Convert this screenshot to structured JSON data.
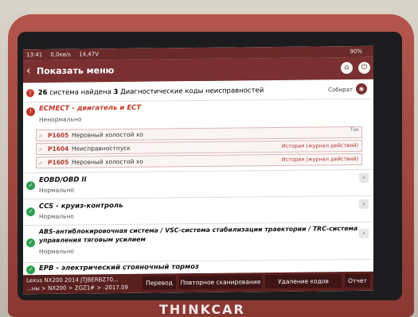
{
  "status_bar": {
    "time": "13:41",
    "net_speed": "0,0кв/s",
    "voltage": "14,47V",
    "battery": "90%"
  },
  "header": {
    "title": "Показать меню"
  },
  "summary": {
    "systems_count": "26",
    "systems_text": "система найдена",
    "dtc_count": "3",
    "dtc_text": "Диагностические коды неисправностей",
    "collect_label": "Собират"
  },
  "systems": [
    {
      "name": "ECMECT - двигатель и ECT",
      "status": "Ненормально",
      "state": "error"
    },
    {
      "name": "EOBD/OBD II",
      "status": "Нормально",
      "state": "ok"
    },
    {
      "name": "CCS - круиз-контроль",
      "status": "Нормально",
      "state": "ok"
    },
    {
      "name": "ABS-антиблокировочная система / VSC-система стабилизации траектории / TRC-система",
      "name2": "управления тяговым усилием",
      "status": "Нормально",
      "state": "ok"
    },
    {
      "name": "EPB - электрический стояночный тормоз",
      "state": "ok"
    }
  ],
  "dtc_list": [
    {
      "code": "P1605",
      "description": "Неровный холостой хо",
      "note": "Ток"
    },
    {
      "code": "P1604",
      "description": "Неисправностпуск",
      "note": "История (журнал действий)"
    },
    {
      "code": "P1605",
      "description": "Неровный холостой хо",
      "note": "История (журнал действий)"
    }
  ],
  "vehicle": {
    "line1": "Lexus  NX200 2014  JTJBERBZ70...",
    "line2": "...ны > NX200 > ZGZ1# > -2017.09"
  },
  "buttons": {
    "translate": "Перевод",
    "rescan": "Повторное сканирование",
    "clear": "Удаление кодов ошибок",
    "report": "Отчет"
  },
  "brand": "THINKCAR"
}
